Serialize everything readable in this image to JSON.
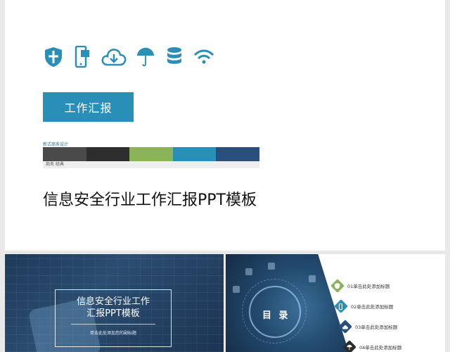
{
  "top_slide": {
    "icons": [
      "shield-icon",
      "mobile-icon",
      "cloud-download-icon",
      "umbrella-icon",
      "database-icon",
      "wifi-icon"
    ],
    "icon_color": "#2a8fb6",
    "title_button": "工作汇报",
    "bar_caption": "新式商务设计",
    "swatches": [
      "#4a4a4a",
      "#2d2d2d",
      "#8ab35a",
      "#2a8fb6",
      "#2a4f7a"
    ],
    "bar_sub": "商务 经典",
    "main_title": "信息安全行业工作汇报PPT模板"
  },
  "bottom_left": {
    "title_line1": "信息安全行业工作",
    "title_line2": "汇报PPT模板",
    "subtitle": "单击此处添加您的副标题"
  },
  "bottom_right": {
    "heading": "目 录",
    "items": [
      {
        "label": "01单击此处添加标题",
        "color": "#8ab35a",
        "icon": "shield-icon"
      },
      {
        "label": "02单击此处添加标题",
        "color": "#2a8fb6",
        "icon": "mobile-icon"
      },
      {
        "label": "03单击此处添加标题",
        "color": "#2a4f7a",
        "icon": "cloud-download-icon"
      },
      {
        "label": "04单击此处添加标题",
        "color": "#2d2d2d",
        "icon": "umbrella-icon"
      }
    ]
  }
}
